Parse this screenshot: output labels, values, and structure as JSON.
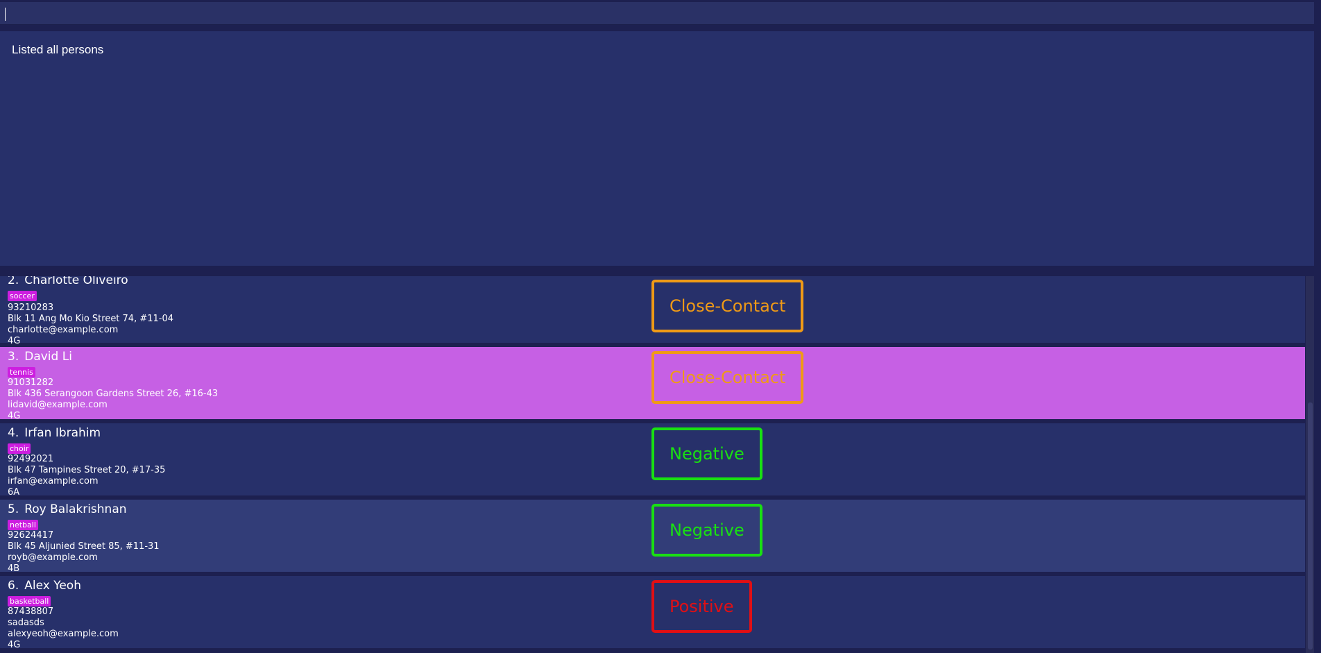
{
  "command": {
    "value": "",
    "placeholder": ""
  },
  "result": {
    "message": "Listed all persons"
  },
  "persons": [
    {
      "index": "2.",
      "name": "Charlotte Oliveiro",
      "tag": "soccer",
      "phone": "93210283",
      "address": "Blk 11 Ang Mo Kio Street 74, #11-04",
      "email": "charlotte@example.com",
      "group": "4G",
      "status": "Close-Contact"
    },
    {
      "index": "3.",
      "name": "David Li",
      "tag": "tennis",
      "phone": "91031282",
      "address": "Blk 436 Serangoon Gardens Street 26, #16-43",
      "email": "lidavid@example.com",
      "group": "4G",
      "status": "Close-Contact"
    },
    {
      "index": "4.",
      "name": "Irfan Ibrahim",
      "tag": "choir",
      "phone": "92492021",
      "address": "Blk 47 Tampines Street 20, #17-35",
      "email": "irfan@example.com",
      "group": "6A",
      "status": "Negative"
    },
    {
      "index": "5.",
      "name": "Roy Balakrishnan",
      "tag": "netball",
      "phone": "92624417",
      "address": "Blk 45 Aljunied Street 85, #11-31",
      "email": "royb@example.com",
      "group": "4B",
      "status": "Negative"
    },
    {
      "index": "6.",
      "name": "Alex Yeoh",
      "tag": "basketball",
      "phone": "87438807",
      "address": "sadasds",
      "email": "alexyeoh@example.com",
      "group": "4G",
      "status": "Positive"
    }
  ],
  "colors": {
    "background": "#1d2050",
    "panel": "#27306a",
    "selected": "#c660e4",
    "tag": "#cd1ee0",
    "close_contact": "#ef9a16",
    "negative": "#19e012",
    "positive": "#e10f14"
  }
}
